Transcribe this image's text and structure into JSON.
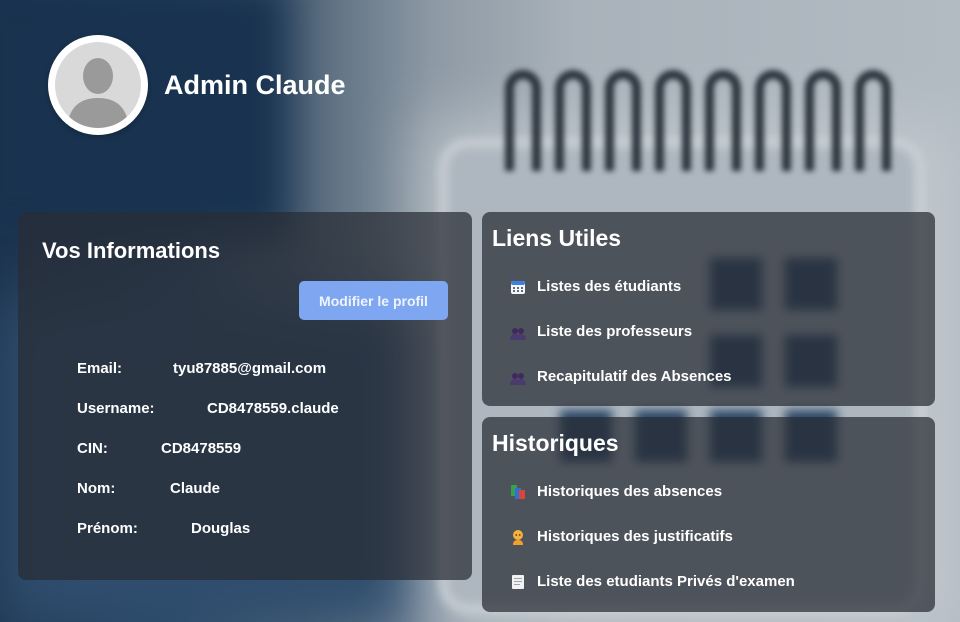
{
  "profile": {
    "name": "Admin Claude"
  },
  "info_panel": {
    "title": "Vos Informations",
    "edit_button": "Modifier le profil",
    "fields": [
      {
        "label": "Email:",
        "value": "tyu87885@gmail.com"
      },
      {
        "label": "Username:",
        "value": "CD8478559.claude"
      },
      {
        "label": "CIN:",
        "value": "CD8478559"
      },
      {
        "label": "Nom:",
        "value": "Claude"
      },
      {
        "label": "Prénom:",
        "value": "Douglas"
      }
    ]
  },
  "links_panel": {
    "title": "Liens Utiles",
    "items": [
      {
        "label": "Listes des étudiants",
        "icon": "calendar-icon"
      },
      {
        "label": "Liste des professeurs",
        "icon": "people-icon"
      },
      {
        "label": "Recapitulatif des Absences",
        "icon": "people-icon"
      }
    ]
  },
  "history_panel": {
    "title": "Historiques",
    "items": [
      {
        "label": "Historiques des absences",
        "icon": "books-icon"
      },
      {
        "label": "Historiques des justificatifs",
        "icon": "person-icon"
      },
      {
        "label": "Liste des etudiants Privés d'examen",
        "icon": "document-icon"
      }
    ]
  }
}
